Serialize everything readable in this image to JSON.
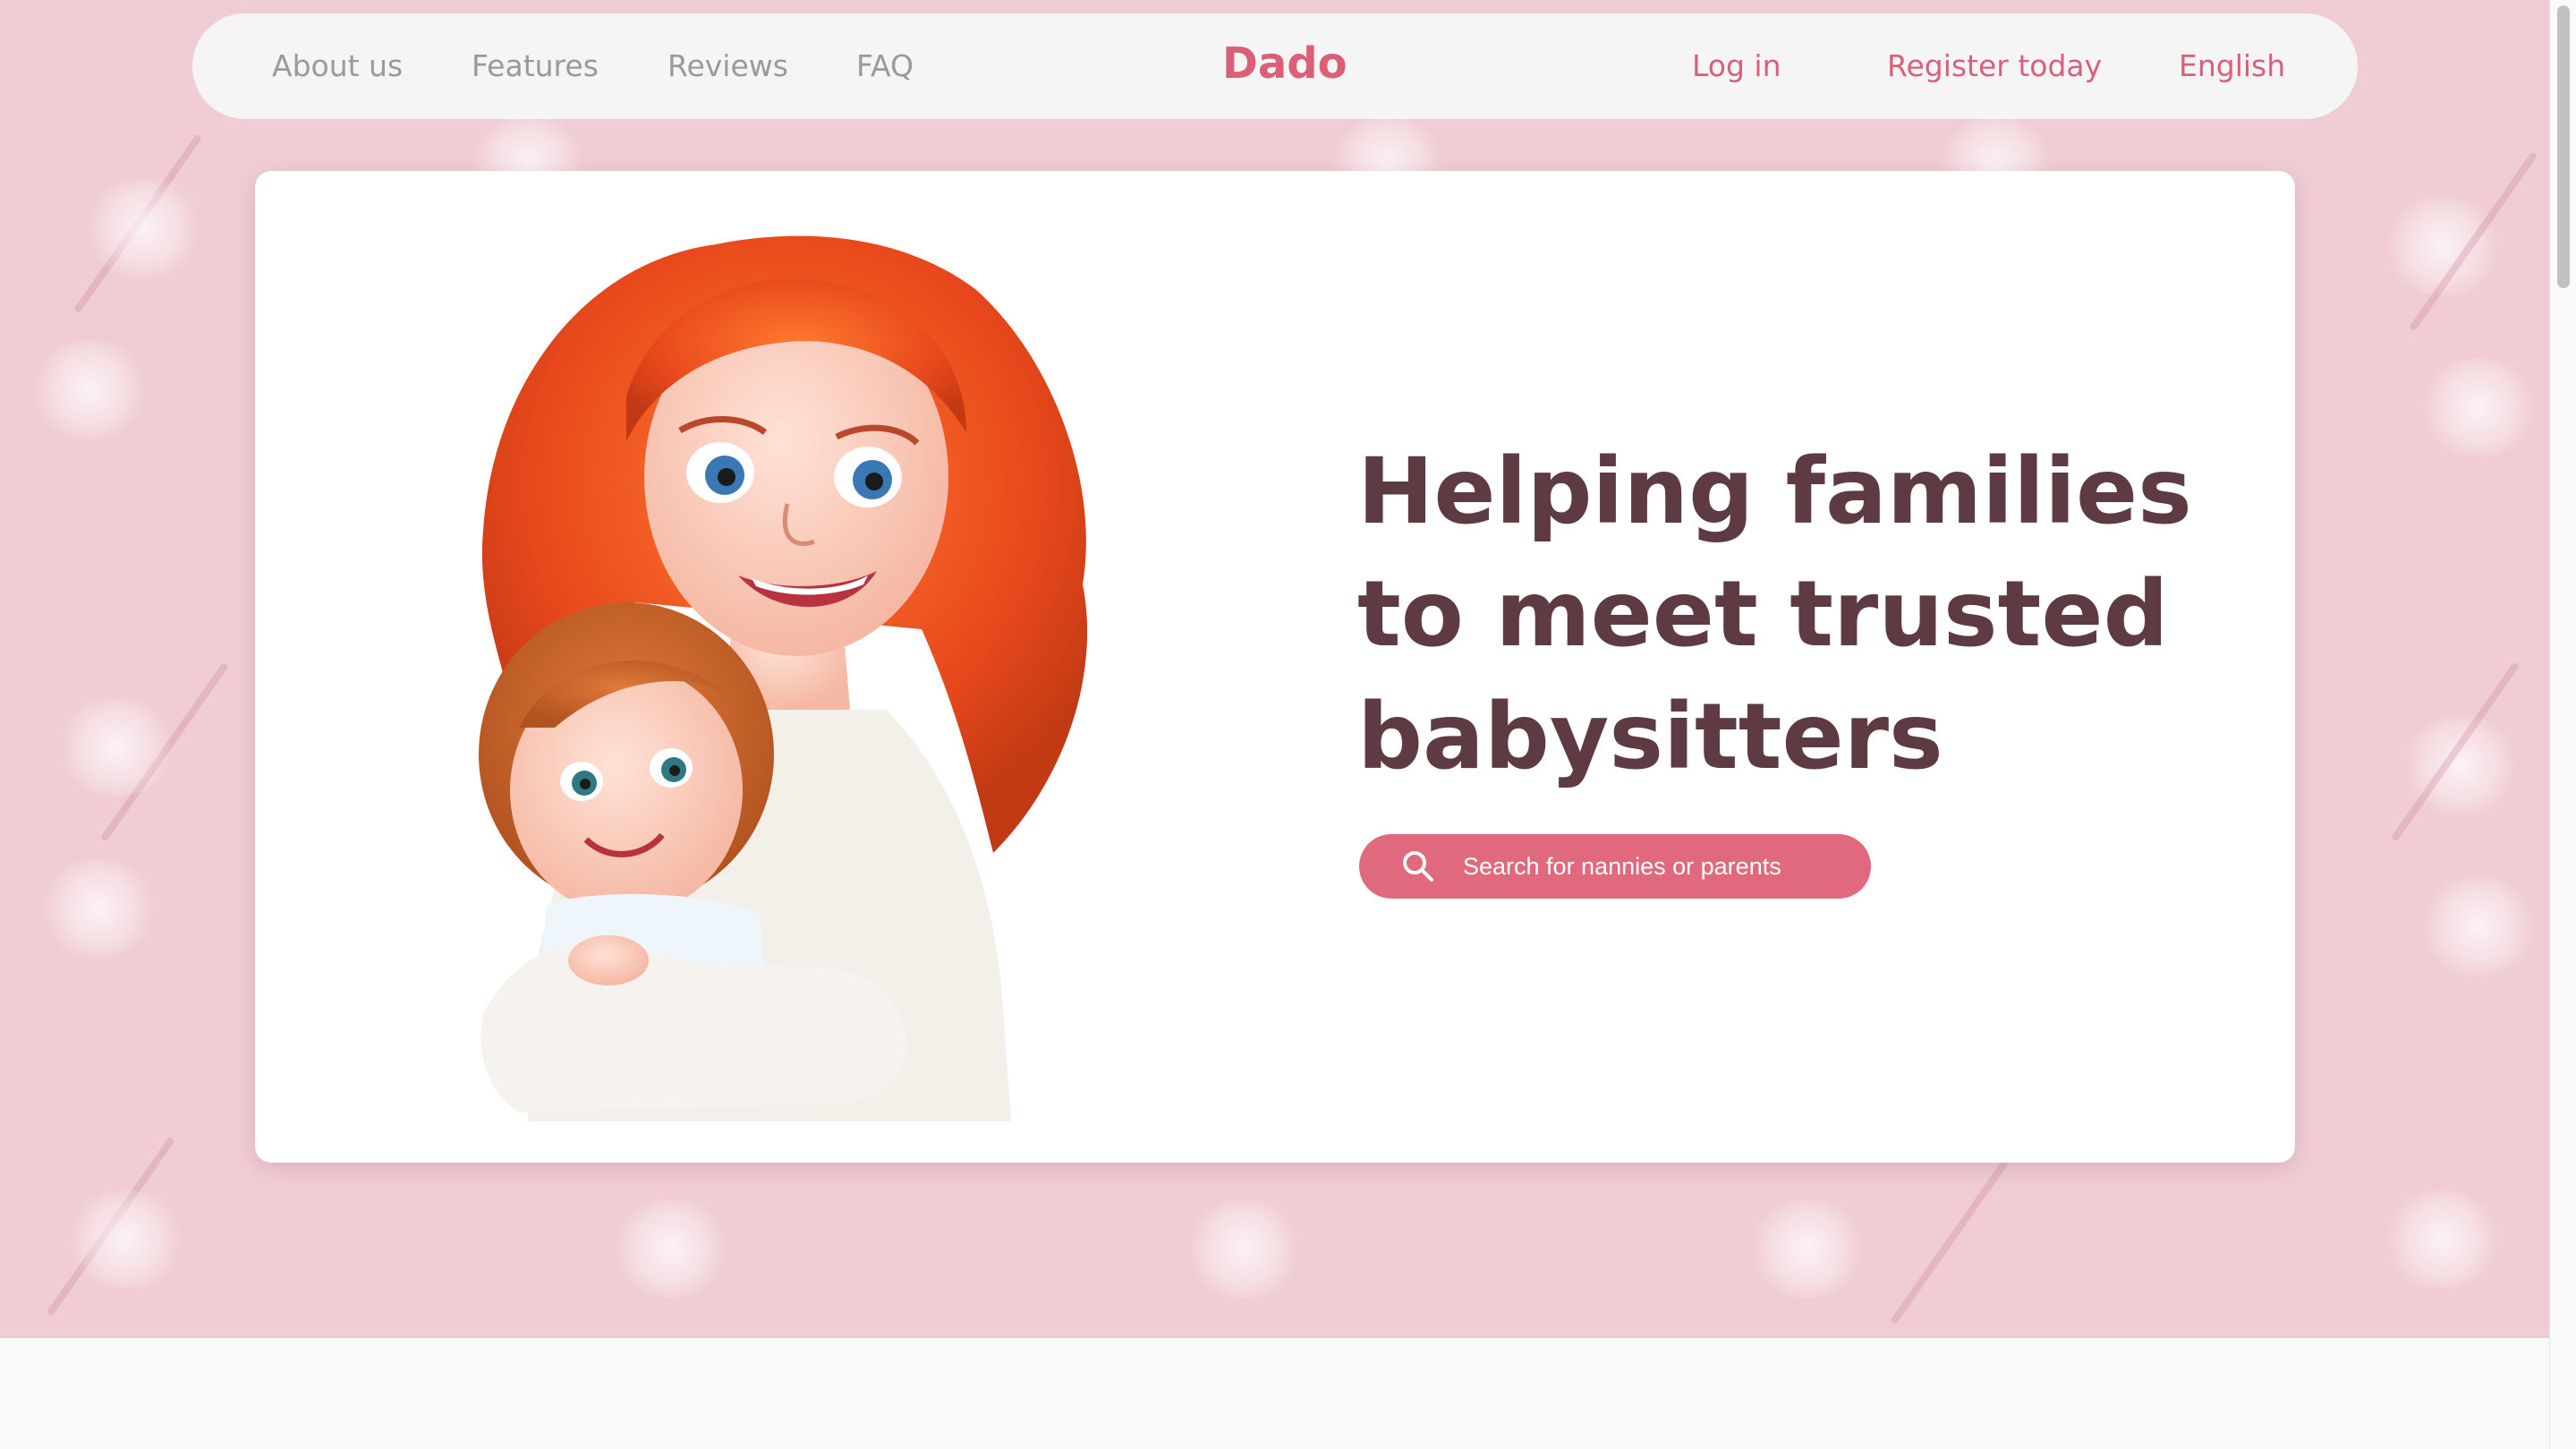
{
  "nav": {
    "left_links": [
      "About us",
      "Features",
      "Reviews",
      "FAQ"
    ],
    "brand": "Dado",
    "login": "Log in",
    "register": "Register today",
    "language": "English"
  },
  "hero": {
    "headline_lines": [
      "Helping families",
      "to meet trusted",
      "babysitters"
    ],
    "search_label": "Search for nannies or parents",
    "illustration": "mother-and-child-illustration"
  },
  "colors": {
    "brand": "#dc5f78",
    "background_pink": "#f0cdd4",
    "headline": "#5e3a42",
    "nav_muted": "#9a9a9a",
    "button": "#e0697e"
  }
}
